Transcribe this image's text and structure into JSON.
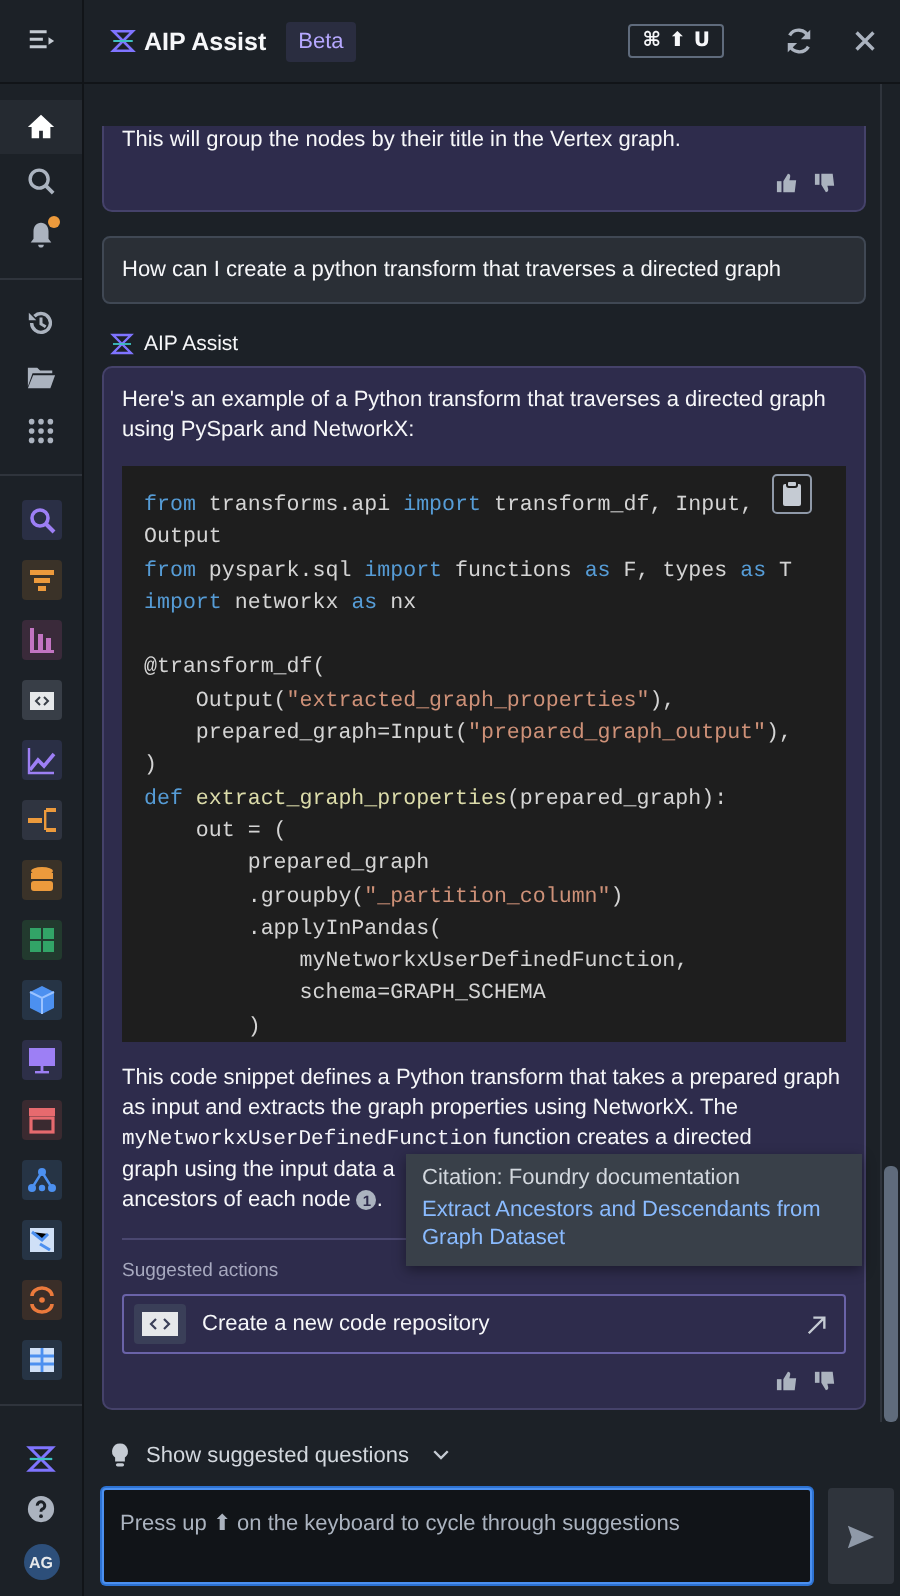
{
  "sidebar": {
    "nav": [
      {
        "kind": "home",
        "selected": true
      },
      {
        "kind": "search",
        "selected": false
      },
      {
        "kind": "notifications",
        "selected": false,
        "unread": true
      }
    ],
    "library": [
      {
        "kind": "history"
      },
      {
        "kind": "folder"
      },
      {
        "kind": "apps"
      }
    ],
    "avatar": "AG"
  },
  "header": {
    "title": "AIP Assist",
    "badge": "Beta",
    "shortcut": [
      "⌘",
      "⬆",
      "U"
    ]
  },
  "messages": [
    {
      "kind": "assistant",
      "text": "This will group the nodes by their title in the Vertex graph."
    },
    {
      "kind": "user",
      "text": "How can I create a python transform that traverses a directed graph"
    },
    {
      "kind": "assistant",
      "author": "AIP Assist",
      "intro": "Here's an example of a Python transform that traverses a directed graph using PySpark and NetworkX:",
      "code": [
        {
          "tokens": [
            {
              "kind": "keyword",
              "text": "from"
            },
            {
              "kind": "plain",
              "text": " transforms.api "
            },
            {
              "kind": "keyword",
              "text": "import"
            },
            {
              "kind": "plain",
              "text": " transform_df, Input,"
            }
          ]
        },
        {
          "tokens": [
            {
              "kind": "plain",
              "text": "Output"
            }
          ]
        },
        {
          "tokens": [
            {
              "kind": "keyword",
              "text": "from"
            },
            {
              "kind": "plain",
              "text": " pyspark.sql "
            },
            {
              "kind": "keyword",
              "text": "import"
            },
            {
              "kind": "plain",
              "text": " functions "
            },
            {
              "kind": "keyword",
              "text": "as"
            },
            {
              "kind": "plain",
              "text": " F, types "
            },
            {
              "kind": "keyword",
              "text": "as"
            },
            {
              "kind": "plain",
              "text": " T"
            }
          ]
        },
        {
          "tokens": [
            {
              "kind": "keyword",
              "text": "import"
            },
            {
              "kind": "plain",
              "text": " networkx "
            },
            {
              "kind": "keyword",
              "text": "as"
            },
            {
              "kind": "plain",
              "text": " nx"
            }
          ]
        },
        {
          "gap_before": true,
          "tokens": [
            {
              "kind": "plain",
              "text": "@transform_df("
            }
          ]
        },
        {
          "tokens": [
            {
              "kind": "plain",
              "text": "    Output("
            },
            {
              "kind": "string",
              "text": "\"extracted_graph_properties\""
            },
            {
              "kind": "plain",
              "text": "),"
            }
          ]
        },
        {
          "tokens": [
            {
              "kind": "plain",
              "text": "    prepared_graph=Input("
            },
            {
              "kind": "string",
              "text": "\"prepared_graph_output\""
            },
            {
              "kind": "plain",
              "text": "),"
            }
          ]
        },
        {
          "tokens": [
            {
              "kind": "plain",
              "text": ")"
            }
          ]
        },
        {
          "tokens": [
            {
              "kind": "keyword",
              "text": "def "
            },
            {
              "kind": "function",
              "text": "extract_graph_properties"
            },
            {
              "kind": "plain",
              "text": "(prepared_graph):"
            }
          ]
        },
        {
          "tokens": [
            {
              "kind": "plain",
              "text": "    out = ("
            }
          ]
        },
        {
          "tokens": [
            {
              "kind": "plain",
              "text": "        prepared_graph"
            }
          ]
        },
        {
          "tokens": [
            {
              "kind": "plain",
              "text": "        .groupby("
            },
            {
              "kind": "string",
              "text": "\"_partition_column\""
            },
            {
              "kind": "plain",
              "text": ")"
            }
          ]
        },
        {
          "tokens": [
            {
              "kind": "plain",
              "text": "        .applyInPandas("
            }
          ]
        },
        {
          "tokens": [
            {
              "kind": "plain",
              "text": "            myNetworkxUserDefinedFunction,"
            }
          ]
        },
        {
          "tokens": [
            {
              "kind": "plain",
              "text": "            schema=GRAPH_SCHEMA"
            }
          ]
        },
        {
          "tokens": [
            {
              "kind": "plain",
              "text": "        )"
            }
          ]
        }
      ],
      "explanation": {
        "before": "This code snippet defines a Python transform that takes a prepared graph as input and extracts the graph properties using NetworkX. The",
        "code": "myNetworkxUserDefinedFunction",
        "after": "function creates a directed",
        "line_4": "graph using the input data a",
        "line_5": "ancestors of each node",
        "citation": "1",
        "end": "."
      },
      "tooltip": {
        "title": "Citation: Foundry documentation",
        "link": "Extract Ancestors and Descendants from Graph Dataset"
      },
      "suggested_label": "Suggested actions",
      "action": "Create a new code repository"
    }
  ],
  "suggestions_toggle": {
    "label": "Show suggested questions",
    "expanded": false
  },
  "composer": {
    "placeholder": "Press up ⬆ on the keyboard to cycle through suggestions"
  }
}
